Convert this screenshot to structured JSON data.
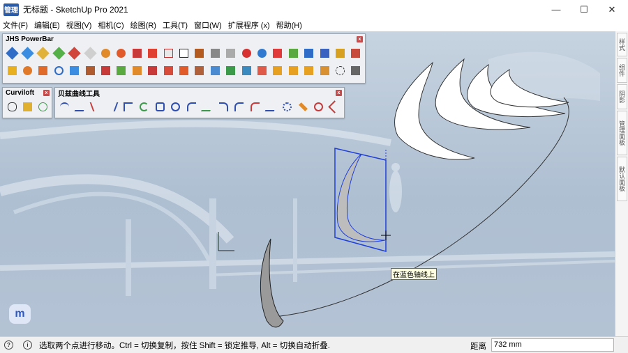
{
  "window": {
    "title": "无标题 - SketchUp Pro 2021",
    "icon_label": "管理",
    "controls": {
      "minimize": "—",
      "maximize": "☐",
      "close": "✕"
    }
  },
  "menu": [
    "文件(F)",
    "编辑(E)",
    "视图(V)",
    "相机(C)",
    "绘图(R)",
    "工具(T)",
    "窗口(W)",
    "扩展程序 (x)",
    "帮助(H)"
  ],
  "toolbars": {
    "jhs": {
      "title": "JHS PowerBar",
      "close": "x"
    },
    "curviloft": {
      "title": "Curviloft",
      "close": "x"
    },
    "bezier": {
      "title": "贝兹曲线工具",
      "close": "x"
    }
  },
  "right_panel": {
    "tabs": [
      "样式",
      "组件",
      "阴影",
      "管理面板",
      "默认面板"
    ]
  },
  "viewport": {
    "tooltip": "在蓝色轴线上",
    "badge": "m"
  },
  "status": {
    "hint": "选取两个点进行移动。Ctrl = 切换复制，按住 Shift = 锁定推导, Alt = 切换自动折叠.",
    "measure_label": "距离",
    "measure_value": "732 mm"
  },
  "colors": {
    "selection_blue": "#1f3fd8",
    "viewport_bg": "#b9c8d8",
    "tooltip_bg": "#ffffe1"
  }
}
